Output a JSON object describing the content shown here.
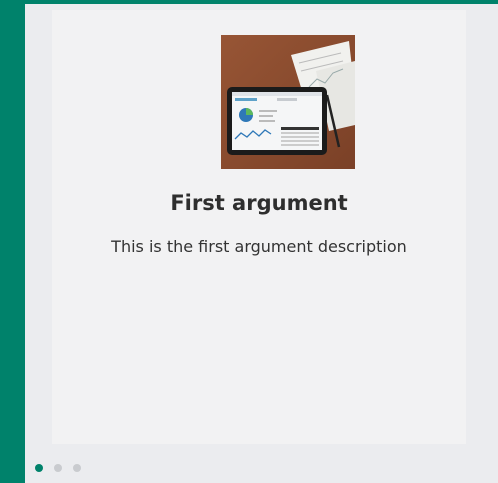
{
  "slide": {
    "title": "First argument",
    "description": "This is the first argument description",
    "image_icon": "tablet-dashboard-image"
  },
  "pagination": {
    "total": 3,
    "active_index": 0
  },
  "colors": {
    "accent": "#00826b",
    "card_bg": "#f2f2f3",
    "frame_bg": "#ebecef",
    "dot_inactive": "#c9cbcf"
  }
}
